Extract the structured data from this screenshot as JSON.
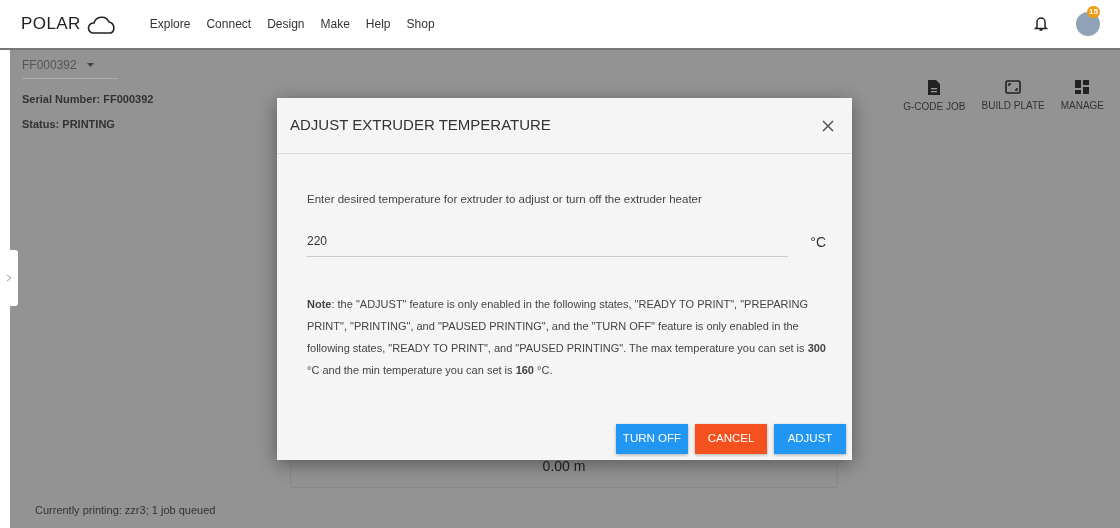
{
  "header": {
    "logo": "POLAR",
    "nav": [
      "Explore",
      "Connect",
      "Design",
      "Make",
      "Help",
      "Shop"
    ],
    "avatar_badge": "15"
  },
  "printer": {
    "selector": "FF000392",
    "serial": "Serial Number: FF000392",
    "status": "Status: PRINTING"
  },
  "toolbar": [
    {
      "kind": "file",
      "label": "G-CODE JOB"
    },
    {
      "kind": "plate",
      "label": "BUILD PLATE"
    },
    {
      "kind": "grid",
      "label": "MANAGE"
    }
  ],
  "background_card": {
    "value": "0.00 m"
  },
  "footer": "Currently printing: zzr3; 1 job queued",
  "dialog": {
    "title": "ADJUST EXTRUDER TEMPERATURE",
    "prompt": "Enter desired temperature for extruder to adjust or turn off the extruder heater",
    "value": "220",
    "unit": "°C",
    "note": "**Note**: the \"ADJUST\" feature is only enabled in the following states, \"READY TO PRINT\", \"PREPARING PRINT\", \"PRINTING\", and \"PAUSED PRINTING\", and the \"TURN OFF\" feature is only enabled in the following states, \"READY TO PRINT\", and \"PAUSED PRINTING\". The max temperature you can set is **300** °C and the min temperature you can set is **160** °C.",
    "buttons": [
      {
        "label": "TURN OFF",
        "kind": "primary"
      },
      {
        "label": "CANCEL",
        "kind": "danger"
      },
      {
        "label": "ADJUST",
        "kind": "primary"
      }
    ]
  }
}
